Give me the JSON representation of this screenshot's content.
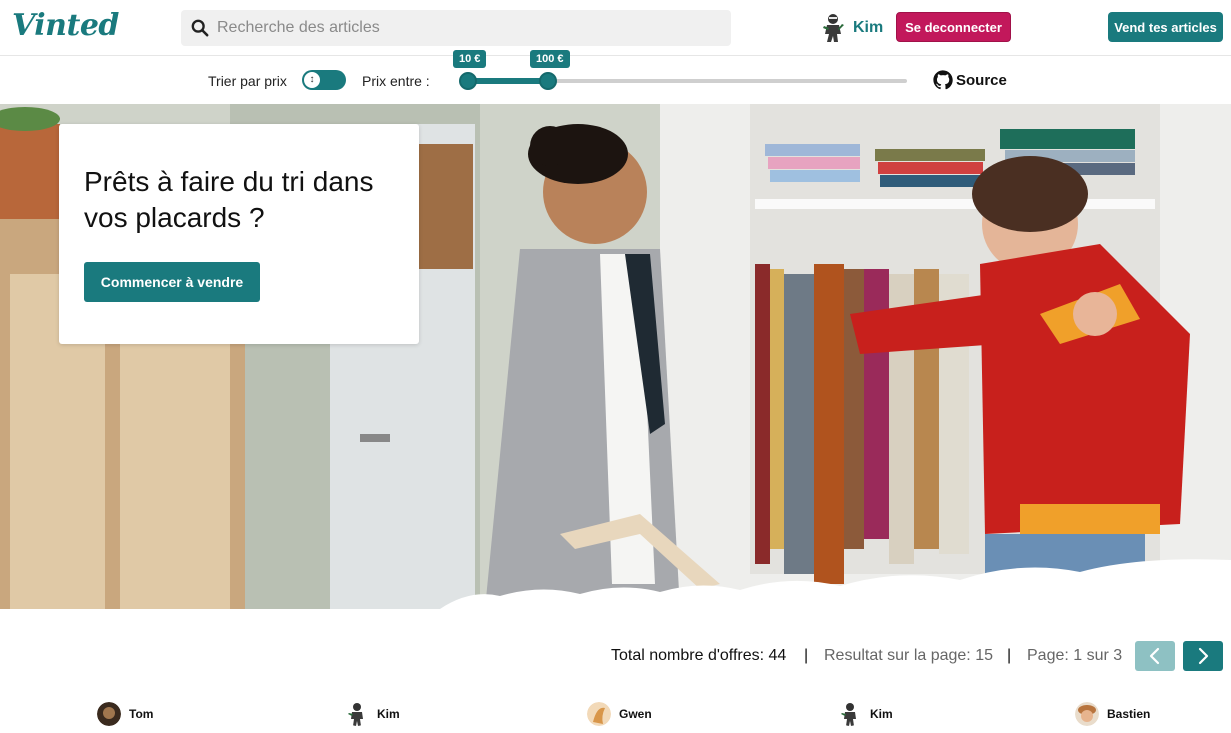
{
  "header": {
    "logo": "Vinted",
    "search_placeholder": "Recherche des articles",
    "user_name": "Kim",
    "logout_label": "Se deconnecter",
    "sell_label": "Vend tes articles"
  },
  "filters": {
    "sort_label": "Trier par prix",
    "price_label": "Prix entre :",
    "min_price": "10 €",
    "max_price": "100 €",
    "source_label": "Source"
  },
  "hero": {
    "title": "Prêts à faire du tri dans vos placards ?",
    "cta_label": "Commencer à vendre"
  },
  "pagination": {
    "total": "Total nombre d'offres: 44",
    "separator": "|",
    "per_page": "Resultat sur la page: 15",
    "page": "Page: 1 sur 3"
  },
  "sellers": [
    {
      "name": "Tom"
    },
    {
      "name": "Kim"
    },
    {
      "name": "Gwen"
    },
    {
      "name": "Kim"
    },
    {
      "name": "Bastien"
    }
  ],
  "colors": {
    "brand": "#1a7a7e",
    "logout": "#c2185b",
    "prev_disabled": "#8ec1c3"
  }
}
